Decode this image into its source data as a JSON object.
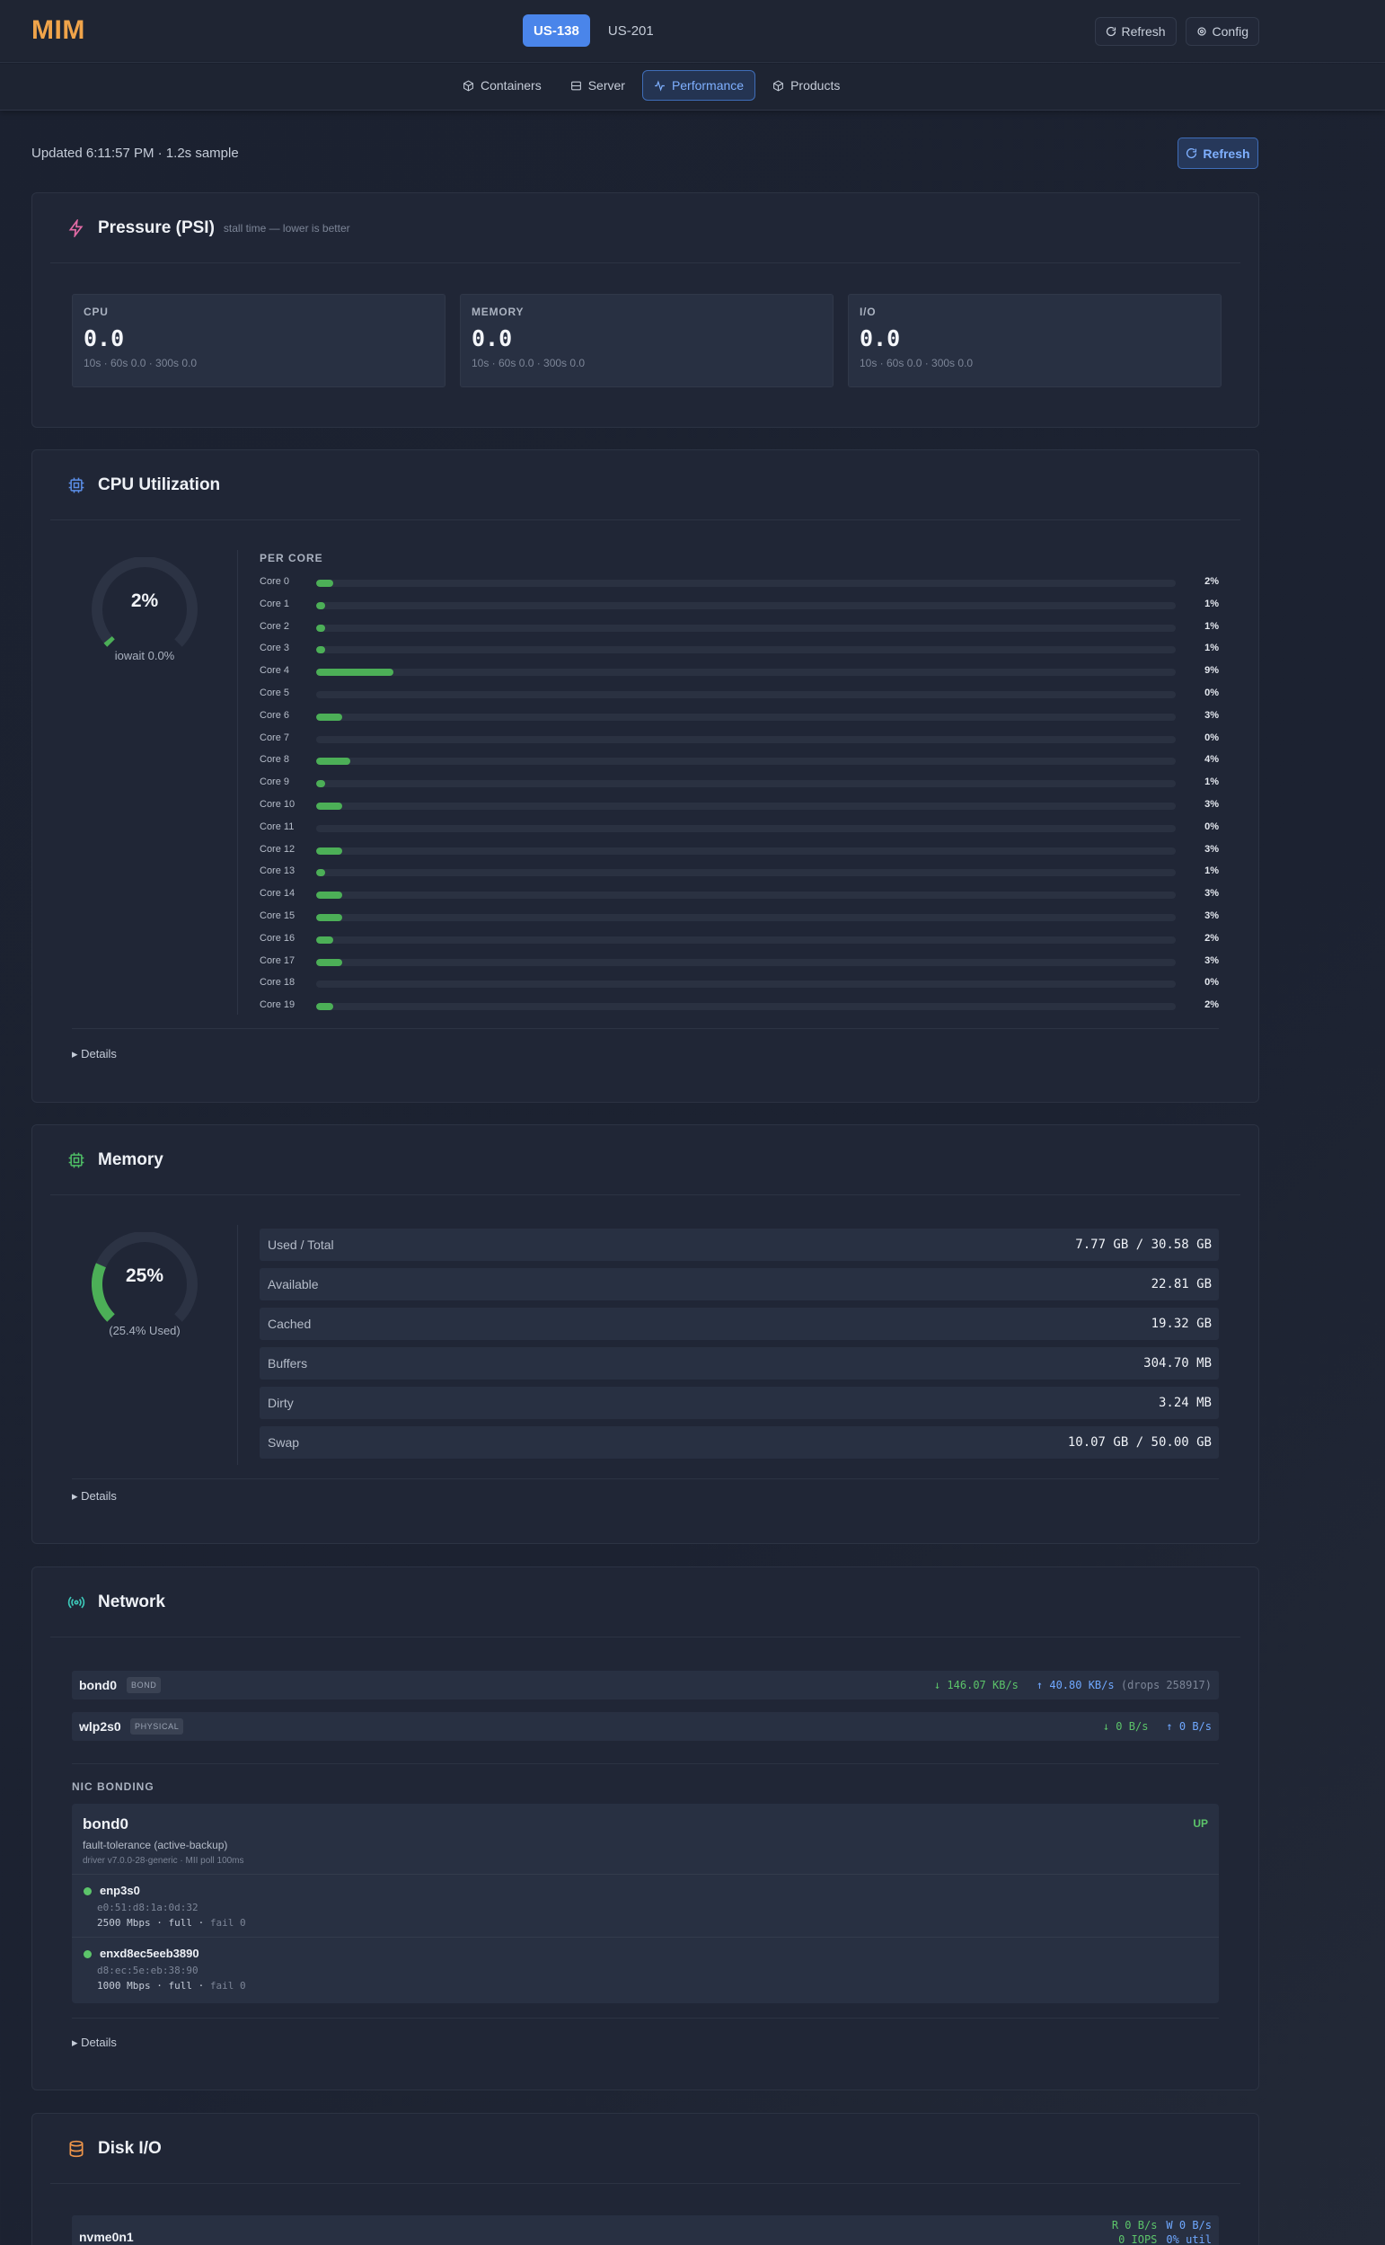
{
  "app": {
    "logo": "MIM"
  },
  "hosts": [
    {
      "label": "US-138",
      "active": true
    },
    {
      "label": "US-201",
      "active": false
    }
  ],
  "top_actions": {
    "refresh": "Refresh",
    "config": "Config"
  },
  "nav": [
    {
      "label": "Containers",
      "icon": "box-icon",
      "active": false
    },
    {
      "label": "Server",
      "icon": "server-icon",
      "active": false
    },
    {
      "label": "Performance",
      "icon": "activity-icon",
      "active": true
    },
    {
      "label": "Products",
      "icon": "box-icon",
      "active": false
    }
  ],
  "status": {
    "updated": "Updated 6:11:57 PM · 1.2s sample",
    "refresh": "Refresh"
  },
  "psi": {
    "title": "Pressure (PSI)",
    "subtitle": "stall time — lower is better",
    "boxes": [
      {
        "label": "CPU",
        "value": "0.0",
        "detail": "10s · 60s 0.0 · 300s 0.0"
      },
      {
        "label": "MEMORY",
        "value": "0.0",
        "detail": "10s · 60s 0.0 · 300s 0.0"
      },
      {
        "label": "I/O",
        "value": "0.0",
        "detail": "10s · 60s 0.0 · 300s 0.0"
      }
    ]
  },
  "cpu": {
    "title": "CPU Utilization",
    "gauge_pct": 2,
    "gauge_label": "2%",
    "iowait": "iowait 0.0%",
    "percore_title": "PER CORE",
    "cores": [
      {
        "name": "Core 0",
        "pct": 2,
        "label": "2%"
      },
      {
        "name": "Core 1",
        "pct": 1,
        "label": "1%"
      },
      {
        "name": "Core 2",
        "pct": 1,
        "label": "1%"
      },
      {
        "name": "Core 3",
        "pct": 1,
        "label": "1%"
      },
      {
        "name": "Core 4",
        "pct": 9,
        "label": "9%"
      },
      {
        "name": "Core 5",
        "pct": 0,
        "label": "0%"
      },
      {
        "name": "Core 6",
        "pct": 3,
        "label": "3%"
      },
      {
        "name": "Core 7",
        "pct": 0,
        "label": "0%"
      },
      {
        "name": "Core 8",
        "pct": 4,
        "label": "4%"
      },
      {
        "name": "Core 9",
        "pct": 1,
        "label": "1%"
      },
      {
        "name": "Core 10",
        "pct": 3,
        "label": "3%"
      },
      {
        "name": "Core 11",
        "pct": 0,
        "label": "0%"
      },
      {
        "name": "Core 12",
        "pct": 3,
        "label": "3%"
      },
      {
        "name": "Core 13",
        "pct": 1,
        "label": "1%"
      },
      {
        "name": "Core 14",
        "pct": 3,
        "label": "3%"
      },
      {
        "name": "Core 15",
        "pct": 3,
        "label": "3%"
      },
      {
        "name": "Core 16",
        "pct": 2,
        "label": "2%"
      },
      {
        "name": "Core 17",
        "pct": 3,
        "label": "3%"
      },
      {
        "name": "Core 18",
        "pct": 0,
        "label": "0%"
      },
      {
        "name": "Core 19",
        "pct": 2,
        "label": "2%"
      }
    ],
    "details": "▸ Details"
  },
  "memory": {
    "title": "Memory",
    "gauge_pct": 25.4,
    "gauge_label": "25%",
    "caption": "(25.4% Used)",
    "rows": [
      {
        "label": "Used / Total",
        "value": "7.77 GB / 30.58 GB"
      },
      {
        "label": "Available",
        "value": "22.81 GB"
      },
      {
        "label": "Cached",
        "value": "19.32 GB"
      },
      {
        "label": "Buffers",
        "value": "304.70 MB"
      },
      {
        "label": "Dirty",
        "value": "3.24 MB"
      },
      {
        "label": "Swap",
        "value": "10.07 GB / 50.00 GB"
      }
    ],
    "details": "▸ Details"
  },
  "network": {
    "title": "Network",
    "interfaces": [
      {
        "name": "bond0",
        "badge": "BOND",
        "rx": "↓ 146.07 KB/s",
        "tx": "↑ 40.80 KB/s",
        "drops": "(drops 258917)"
      },
      {
        "name": "wlp2s0",
        "badge": "PHYSICAL",
        "rx": "↓ 0 B/s",
        "tx": "↑ 0 B/s",
        "drops": ""
      }
    ],
    "bonding_label": "NIC BONDING",
    "bond": {
      "name": "bond0",
      "mode": "fault-tolerance (active-backup)",
      "driver": "driver v7.0.0-28-generic · MII poll 100ms",
      "state": "UP",
      "slaves": [
        {
          "name": "enp3s0",
          "mac": "e0:51:d8:1a:0d:32",
          "speed": "2500 Mbps",
          "duplex": "full",
          "fail": "fail 0"
        },
        {
          "name": "enxd8ec5eeb3890",
          "mac": "d8:ec:5e:eb:38:90",
          "speed": "1000 Mbps",
          "duplex": "full",
          "fail": "fail 0"
        }
      ]
    },
    "details": "▸ Details"
  },
  "disk": {
    "title": "Disk I/O",
    "devices": [
      {
        "name": "nvme0n1",
        "read": "R 0 B/s",
        "write": "W 0 B/s",
        "iops": "0 IOPS",
        "util": "0% util"
      }
    ]
  },
  "colors": {
    "accent": "#4a85ea",
    "logo": "#f0a44a",
    "bar_green": "#4caf57",
    "rx": "#5cc46a",
    "tx": "#6fa8ff",
    "psi_icon": "#e26aa5",
    "cpu_icon": "#5b8ee8",
    "mem_icon": "#4fc167",
    "net_icon": "#3cc7b8",
    "disk_icon": "#f0964a"
  }
}
